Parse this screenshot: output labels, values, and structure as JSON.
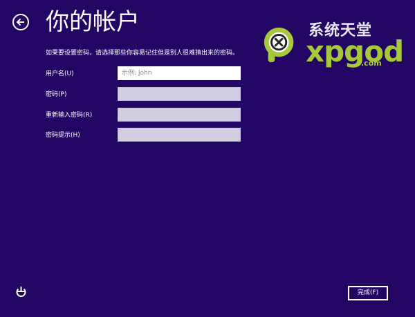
{
  "page": {
    "title": "你的帐户",
    "description": "如果要设置密码，请选择那些你容易记住但是别人很难猜出来的密码。"
  },
  "form": {
    "fields": [
      {
        "label": "用户名(U)",
        "placeholder": "示例: John",
        "value": "",
        "focused": true
      },
      {
        "label": "密码(P)",
        "placeholder": "",
        "value": ""
      },
      {
        "label": "重新输入密码(R)",
        "placeholder": "",
        "value": ""
      },
      {
        "label": "密码提示(H)",
        "placeholder": "",
        "value": ""
      }
    ]
  },
  "footer": {
    "finish_label": "完成(F)",
    "ease_of_access_icon": "ease-of-access-icon"
  },
  "watermark": {
    "chinese": "系统天堂",
    "brand": "xpgod",
    "domain": ".com"
  },
  "colors": {
    "background": "#230564",
    "text": "#ffffff",
    "input_bg": "#d2cde3",
    "watermark_green": "#a6c93a"
  },
  "icons": {
    "back": "back-arrow-icon",
    "logo": "xpgod-logo-icon"
  }
}
